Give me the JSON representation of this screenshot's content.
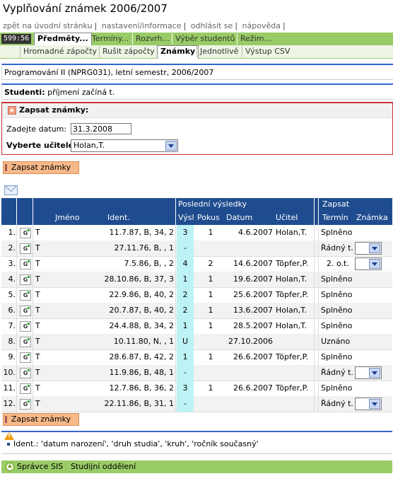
{
  "title": "Vyplňování známek 2006/2007",
  "toplinks": [
    "zpět na úvodní stránku",
    "nastavení/informace",
    "odhlásit se",
    "nápověda"
  ],
  "timer": "599:56",
  "main_tabs": [
    "Předměty...",
    "Termíny...",
    "Rozvrh...",
    "Výběr studentů",
    "Režim..."
  ],
  "sub_tabs": [
    "Hromadné zápočty",
    "Rušit zápočty",
    "Známky",
    "Jednotlivě",
    "Výstup CSV"
  ],
  "subject": "Programování II (NPRG031), letní semestr, 2006/2007",
  "students_label": "Studenti:",
  "students_value": "příjmení začíná t.",
  "form": {
    "title": "Zapsat známky:",
    "date_label": "Zadejte datum:",
    "date_value": "31.3.2008",
    "teacher_label": "Vyberte učitele:",
    "teacher_value": "Holan,T.",
    "submit": "Zapsat známky"
  },
  "table": {
    "group_last": "Poslední výsledky",
    "group_write": "Zapsat",
    "col_name": "Jméno",
    "col_ident": "Ident.",
    "col_vysl": "Výsl",
    "col_pokus": "Pokus",
    "col_datum": "Datum",
    "col_ucitel": "Učitel",
    "col_termin": "Termín",
    "col_znamka": "Známka",
    "rows": [
      {
        "n": "1.",
        "name": "T",
        "ident": "11.7.87, B, 34, 2",
        "vysl": "3",
        "pokus": "1",
        "datum": "4.6.2007",
        "ucitel": "Holan,T.",
        "termin": "Splněno",
        "dd": false
      },
      {
        "n": "2.",
        "name": "T",
        "ident": "27.11.76, B, , 1",
        "vysl": "-",
        "pokus": "",
        "datum": "",
        "ucitel": "",
        "termin": "Řádný t.",
        "dd": true
      },
      {
        "n": "3.",
        "name": "T",
        "ident": "7.5.86, B, , 2",
        "vysl": "4",
        "pokus": "2",
        "datum": "14.6.2007",
        "ucitel": "Töpfer,P.",
        "termin": "2. o.t.",
        "dd": true
      },
      {
        "n": "4.",
        "name": "T",
        "ident": "28.10.86, B, 37, 3",
        "vysl": "1",
        "pokus": "1",
        "datum": "19.6.2007",
        "ucitel": "Holan,T.",
        "termin": "Splněno",
        "dd": false
      },
      {
        "n": "5.",
        "name": "T",
        "ident": "22.9.86, B, 40, 2",
        "vysl": "2",
        "pokus": "1",
        "datum": "25.6.2007",
        "ucitel": "Töpfer,P.",
        "termin": "Splněno",
        "dd": false
      },
      {
        "n": "6.",
        "name": "T",
        "ident": "20.7.87, B, 40, 2",
        "vysl": "2",
        "pokus": "1",
        "datum": "13.6.2007",
        "ucitel": "Holan,T.",
        "termin": "Splněno",
        "dd": false
      },
      {
        "n": "7.",
        "name": "T",
        "ident": "24.4.88, B, 34, 2",
        "vysl": "1",
        "pokus": "1",
        "datum": "28.5.2007",
        "ucitel": "Holan,T.",
        "termin": "Splněno",
        "dd": false
      },
      {
        "n": "8.",
        "name": "T",
        "ident": "10.11.80, N, , 1",
        "vysl": "U",
        "pokus": "",
        "datum": "27.10.2006",
        "ucitel": "",
        "termin": "Uznáno",
        "dd": false
      },
      {
        "n": "9.",
        "name": "T",
        "ident": "28.6.87, B, 42, 2",
        "vysl": "1",
        "pokus": "1",
        "datum": "26.6.2007",
        "ucitel": "Töpfer,P.",
        "termin": "Splněno",
        "dd": false
      },
      {
        "n": "10.",
        "name": "T",
        "ident": "11.9.86, B, 48, 1",
        "vysl": "-",
        "pokus": "",
        "datum": "",
        "ucitel": "",
        "termin": "Řádný t.",
        "dd": true
      },
      {
        "n": "11.",
        "name": "T",
        "ident": "12.7.86, B, 36, 2",
        "vysl": "3",
        "pokus": "1",
        "datum": "26.6.2007",
        "ucitel": "Töpfer,P.",
        "termin": "Splněno",
        "dd": false
      },
      {
        "n": "12.",
        "name": "T",
        "ident": "22.11.86, B, 31, 1",
        "vysl": "-",
        "pokus": "",
        "datum": "",
        "ucitel": "",
        "termin": "Řádný t.",
        "dd": true
      }
    ]
  },
  "note": "Ident.: 'datum narození', 'druh studia', 'kruh', 'ročník současný'",
  "footer": [
    "Správce SIS",
    "Studijní oddělení"
  ]
}
